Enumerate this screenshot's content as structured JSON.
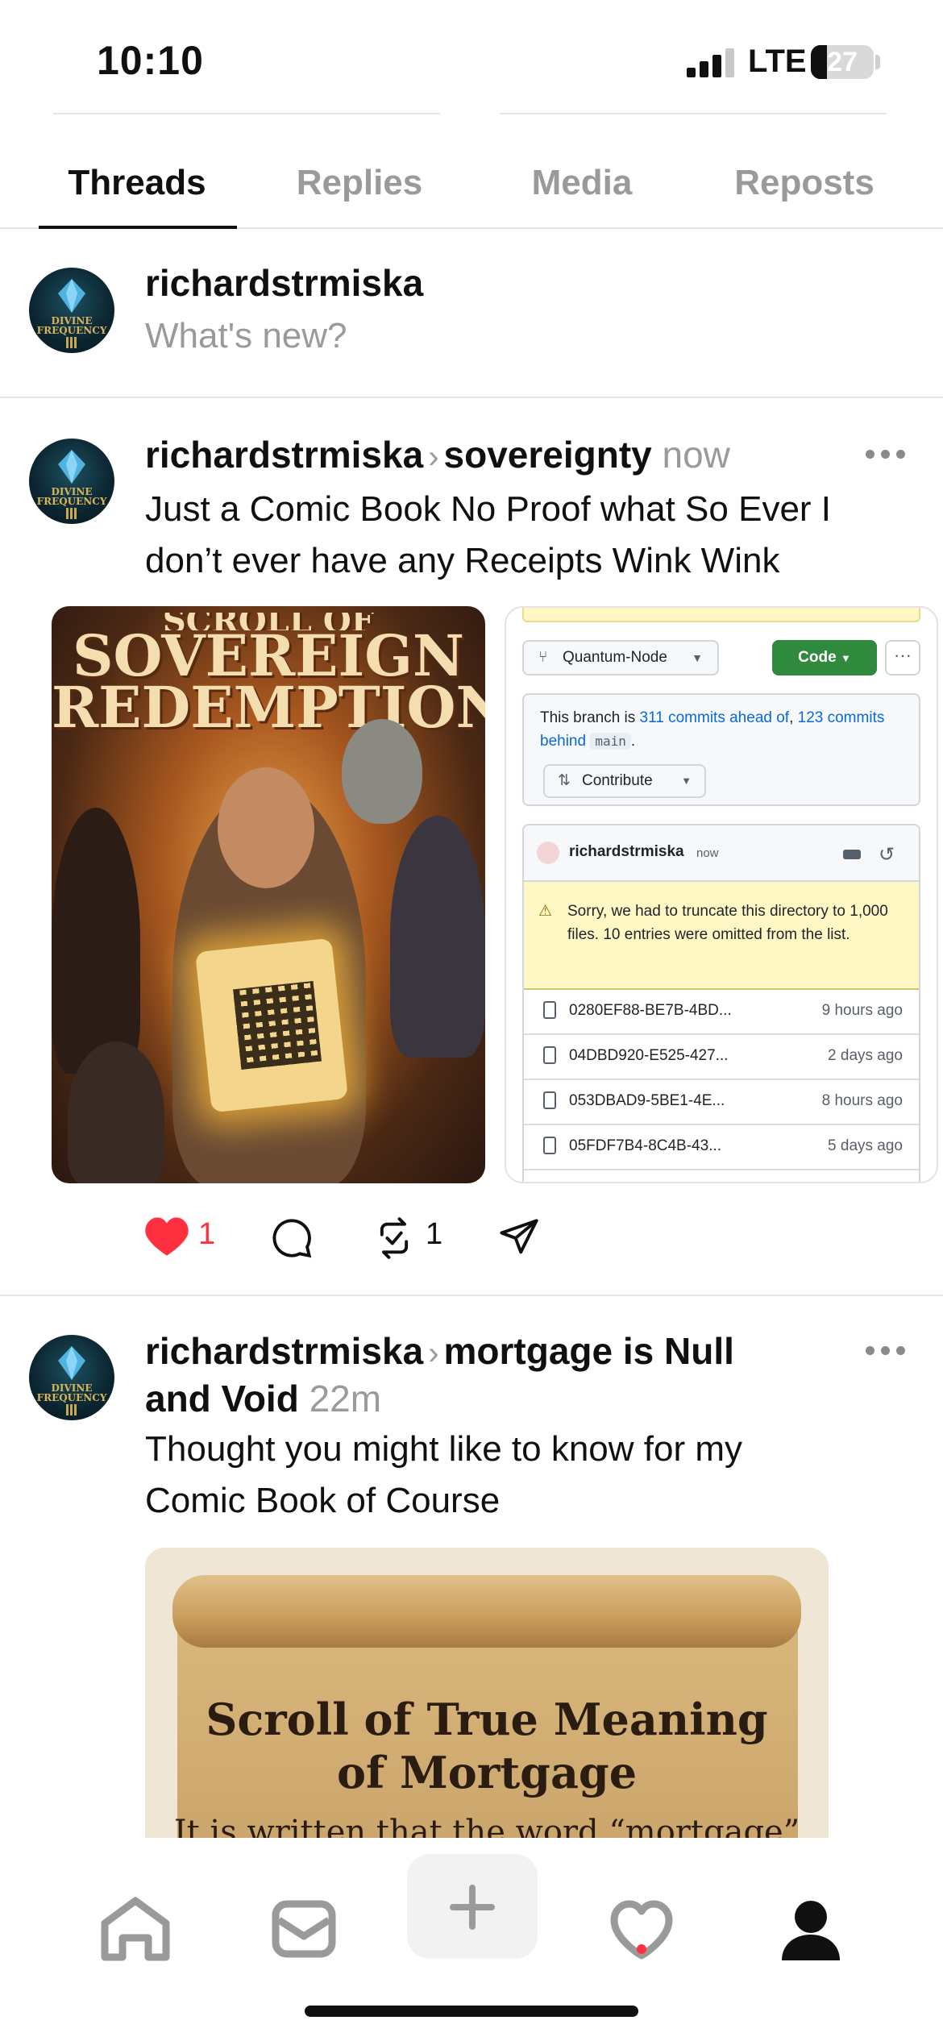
{
  "status_bar": {
    "time": "10:10",
    "network": "LTE",
    "battery": "27"
  },
  "tabs": [
    "Threads",
    "Replies",
    "Media",
    "Reposts"
  ],
  "composer": {
    "username": "richardstrmiska",
    "prompt": "What's new?"
  },
  "avatar": {
    "text_line1": "DIVINE",
    "text_line2": "FREQUENCY"
  },
  "post1": {
    "username": "richardstrmiska",
    "topic": "sovereignty",
    "time": "now",
    "text_line1": "Just a Comic Book No Proof what So Ever I",
    "text_line2": "don’t ever have any Receipts Wink Wink",
    "comic": {
      "title_small": "SCROLL OF",
      "title_line1": "SOVEREIGN",
      "title_line2": "REDEMPTION"
    },
    "github": {
      "branch": "Quantum-Node",
      "code_label": "Code",
      "branch_text_pre": "This branch is ",
      "ahead": "311 commits ahead of",
      "comma": ", ",
      "behind": "123 commits behind",
      "main": "main",
      "period": ".",
      "contribute": "Contribute",
      "list_user": "richardstrmiska",
      "list_time": "now",
      "warning": "Sorry, we had to truncate this directory to 1,000 files. 10 entries were omitted from the list.",
      "files": [
        {
          "name": "0280EF88-BE7B-4BD...",
          "ago": "9 hours ago"
        },
        {
          "name": "04DBD920-E525-427...",
          "ago": "2 days ago"
        },
        {
          "name": "053DBAD9-5BE1-4E...",
          "ago": "8 hours ago"
        },
        {
          "name": "05FDF7B4-8C4B-43...",
          "ago": "5 days ago"
        }
      ]
    },
    "likes": "1",
    "reposts": "1"
  },
  "post2": {
    "username": "richardstrmiska",
    "topic_line1": "mortgage is Null",
    "topic_line2": "and Void",
    "time": "22m",
    "text_line1": "Thought you might like to know for my",
    "text_line2": "Comic Book of Course",
    "scroll_title_line1": "Scroll of True Meaning",
    "scroll_title_line2": "of Mortgage",
    "scroll_text": "It is written that the word “mortgage”"
  },
  "colors": {
    "like_red": "#ff3040",
    "github_green": "#2f8a3d",
    "link_blue": "#0969da"
  },
  "icons": [
    "signal-icon",
    "battery-icon",
    "chevron-right-icon",
    "more-icon",
    "heart-icon",
    "comment-icon",
    "repost-icon",
    "share-icon",
    "home-icon",
    "inbox-icon",
    "plus-icon",
    "activity-heart-icon",
    "profile-icon"
  ]
}
